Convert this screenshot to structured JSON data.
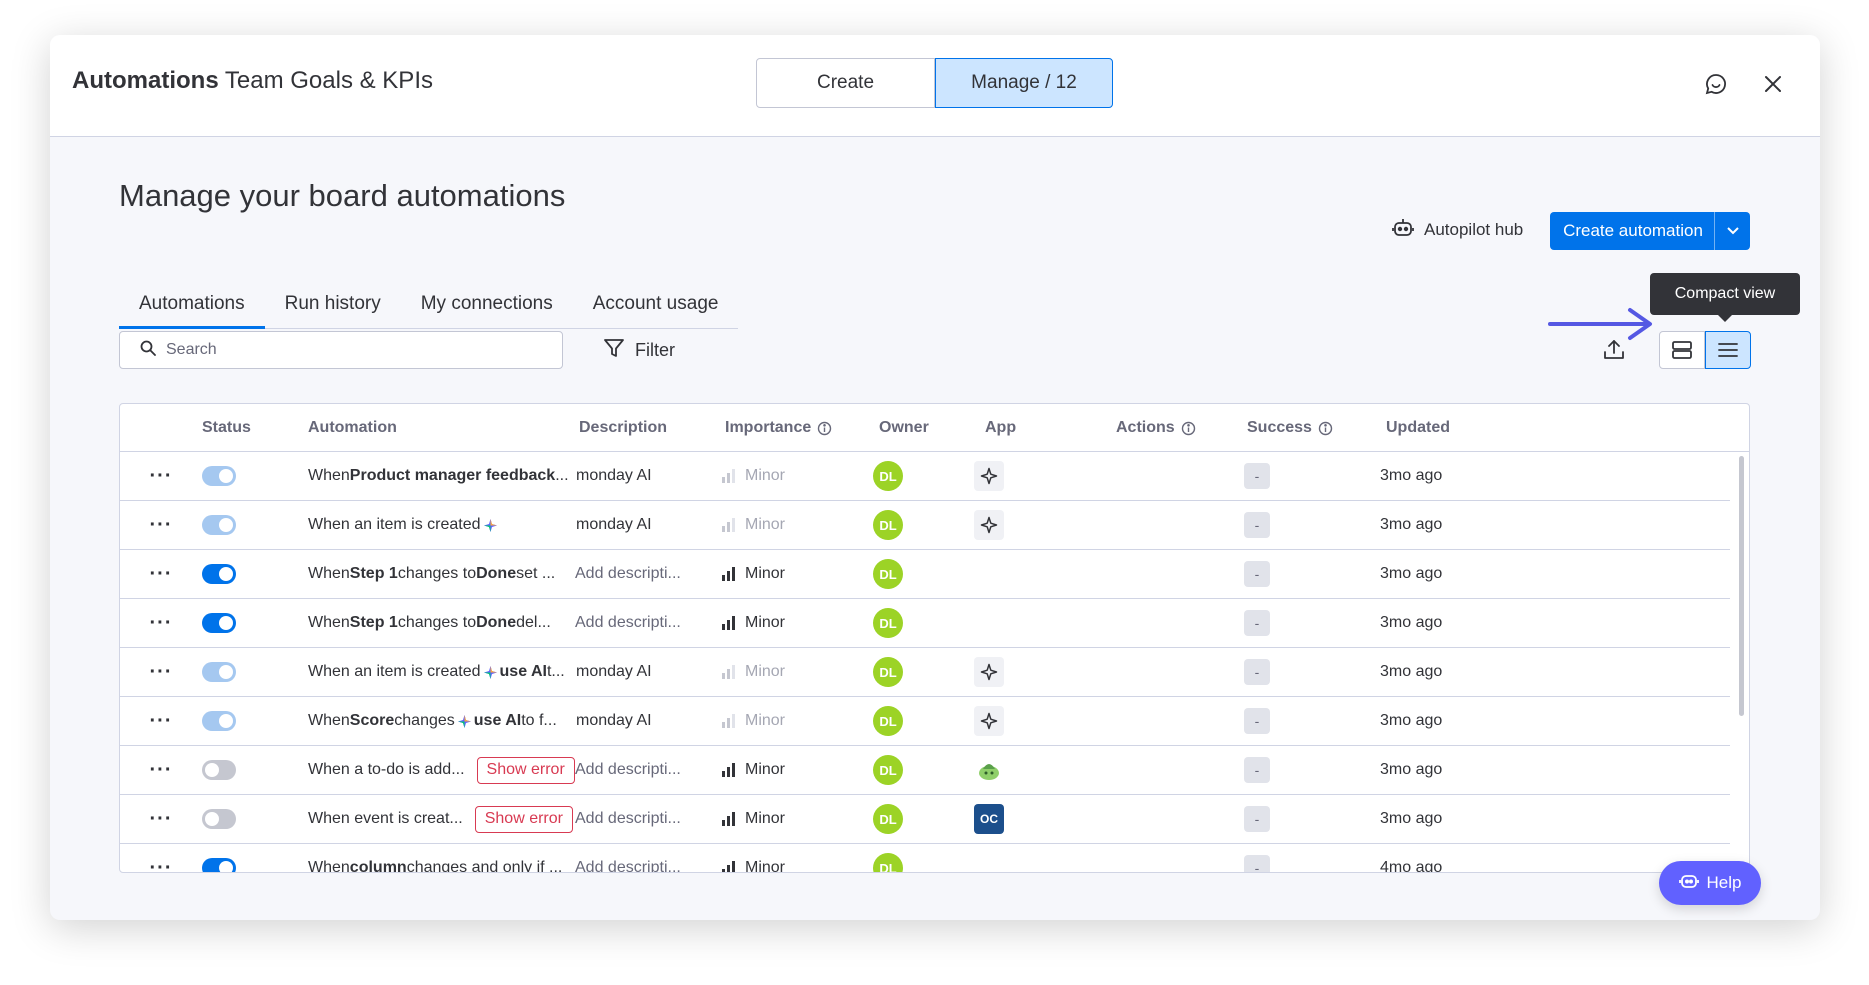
{
  "header": {
    "title_bold": "Automations",
    "title_rest": " Team Goals & KPIs",
    "seg_create": "Create",
    "seg_manage": "Manage / 12",
    "feedback_icon": "chat-feedback-icon",
    "close_icon": "close-icon"
  },
  "page": {
    "title": "Manage your board automations",
    "autopilot_label": "Autopilot hub",
    "create_label": "Create automation"
  },
  "tabs": [
    {
      "label": "Automations",
      "active": true
    },
    {
      "label": "Run history"
    },
    {
      "label": "My connections"
    },
    {
      "label": "Account usage"
    }
  ],
  "toolbar": {
    "search_placeholder": "Search",
    "filter_label": "Filter",
    "tooltip": "Compact view"
  },
  "columns": {
    "status": "Status",
    "automation": "Automation",
    "description": "Description",
    "importance": "Importance",
    "owner": "Owner",
    "app": "App",
    "actions": "Actions",
    "success": "Success",
    "updated": "Updated"
  },
  "rows": [
    {
      "status": "dim",
      "automation": [
        {
          "t": "When "
        },
        {
          "t": "Product manager feedback",
          "b": true
        },
        {
          "t": " ..."
        }
      ],
      "description": "monday AI",
      "desc_placeholder": false,
      "importance": "Minor",
      "imp_dim": true,
      "owner": "DL",
      "app": "sparkle",
      "success": "-",
      "updated": "3mo ago"
    },
    {
      "status": "dim",
      "automation": [
        {
          "t": "When an item is created"
        },
        {
          "spark": true
        }
      ],
      "description": "monday AI",
      "desc_placeholder": false,
      "importance": "Minor",
      "imp_dim": true,
      "owner": "DL",
      "app": "sparkle",
      "success": "-",
      "updated": "3mo ago"
    },
    {
      "status": "on",
      "automation": [
        {
          "t": "When "
        },
        {
          "t": "Step 1",
          "b": true
        },
        {
          "t": " changes to "
        },
        {
          "t": "Done",
          "b": true
        },
        {
          "t": " set ..."
        }
      ],
      "description": "Add descripti...",
      "desc_placeholder": true,
      "importance": "Minor",
      "imp_dim": false,
      "owner": "DL",
      "app": "",
      "success": "-",
      "updated": "3mo ago"
    },
    {
      "status": "on",
      "automation": [
        {
          "t": "When "
        },
        {
          "t": "Step 1",
          "b": true
        },
        {
          "t": " changes to "
        },
        {
          "t": "Done",
          "b": true
        },
        {
          "t": " del..."
        }
      ],
      "description": "Add descripti...",
      "desc_placeholder": true,
      "importance": "Minor",
      "imp_dim": false,
      "owner": "DL",
      "app": "",
      "success": "-",
      "updated": "3mo ago"
    },
    {
      "status": "dim",
      "automation": [
        {
          "t": "When an item is created"
        },
        {
          "spark": true
        },
        {
          "t": "use AI",
          "b": true
        },
        {
          "t": " t..."
        }
      ],
      "description": "monday AI",
      "desc_placeholder": false,
      "importance": "Minor",
      "imp_dim": true,
      "owner": "DL",
      "app": "sparkle",
      "success": "-",
      "updated": "3mo ago"
    },
    {
      "status": "dim",
      "automation": [
        {
          "t": "When "
        },
        {
          "t": "Score",
          "b": true
        },
        {
          "t": " changes"
        },
        {
          "spark": true
        },
        {
          "t": "use AI",
          "b": true
        },
        {
          "t": " to f..."
        }
      ],
      "description": "monday AI",
      "desc_placeholder": false,
      "importance": "Minor",
      "imp_dim": true,
      "owner": "DL",
      "app": "sparkle",
      "success": "-",
      "updated": "3mo ago"
    },
    {
      "status": "off",
      "automation": [
        {
          "t": "When a to-do is add..."
        }
      ],
      "error": "Show error",
      "description": "Add descripti...",
      "desc_placeholder": true,
      "importance": "Minor",
      "imp_dim": false,
      "owner": "DL",
      "app": "leaf",
      "success": "-",
      "updated": "3mo ago"
    },
    {
      "status": "off",
      "automation": [
        {
          "t": "When event is creat..."
        }
      ],
      "error": "Show error",
      "description": "Add descripti...",
      "desc_placeholder": true,
      "importance": "Minor",
      "imp_dim": false,
      "owner": "DL",
      "app": "oc",
      "app_text": "OC",
      "success": "-",
      "updated": "3mo ago"
    },
    {
      "status": "on",
      "automation": [
        {
          "t": "When "
        },
        {
          "t": "column",
          "b": true
        },
        {
          "t": " changes and only if ..."
        }
      ],
      "description": "Add descripti...",
      "desc_placeholder": true,
      "importance": "Minor",
      "imp_dim": false,
      "owner": "DL",
      "app": "",
      "success": "-",
      "updated": "4mo ago"
    }
  ],
  "help_label": "Help",
  "colors": {
    "primary": "#0073ea",
    "owner_avatar": "#9cd326",
    "error": "#d83a52",
    "help": "#6161ff"
  }
}
